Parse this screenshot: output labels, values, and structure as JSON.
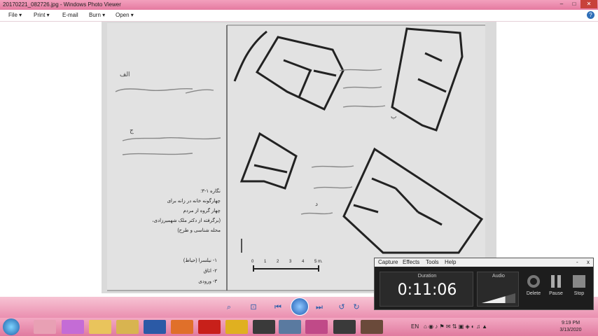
{
  "window": {
    "title": "20170221_082726.jpg - Windows Photo Viewer",
    "minimize": "–",
    "maximize": "□",
    "close": "✕"
  },
  "menu": {
    "file": "File",
    "print": "Print",
    "email": "E-mail",
    "burn": "Burn",
    "open": "Open",
    "help": "?"
  },
  "photo": {
    "caption_lines": [
      "نگاره ۱-۳:",
      "چهارگونه خانه در زانه برای",
      "چهار گروه از مردم",
      "(برگرفته از دکتر ملک شهمیرزادی،",
      "محله شناسی و طرح)"
    ],
    "legend_lines": [
      "۱- نیلسرا (حیاط)",
      "۲- اتاق",
      "۳- ورودی"
    ],
    "scale_ticks": [
      "0",
      "1",
      "2",
      "3",
      "4",
      "5 m."
    ],
    "note_labels": [
      "الف",
      "ب",
      "ج",
      "د"
    ]
  },
  "recorder": {
    "menu": [
      "Capture",
      "Effects",
      "Tools",
      "Help"
    ],
    "duration_label": "Duration",
    "duration": "0:11:06",
    "audio_label": "Audio",
    "audio_level": 0.7,
    "delete": "Delete",
    "pause": "Pause",
    "stop": "Stop",
    "close": "x",
    "minimize": "-"
  },
  "taskbar": {
    "lang": "EN",
    "time": "9:19 PM",
    "date": "3/13/2020"
  },
  "colors": {
    "chrome_pink": "#e57aa0",
    "close_red": "#c8423a",
    "recorder_bg": "#1d1d1d"
  }
}
